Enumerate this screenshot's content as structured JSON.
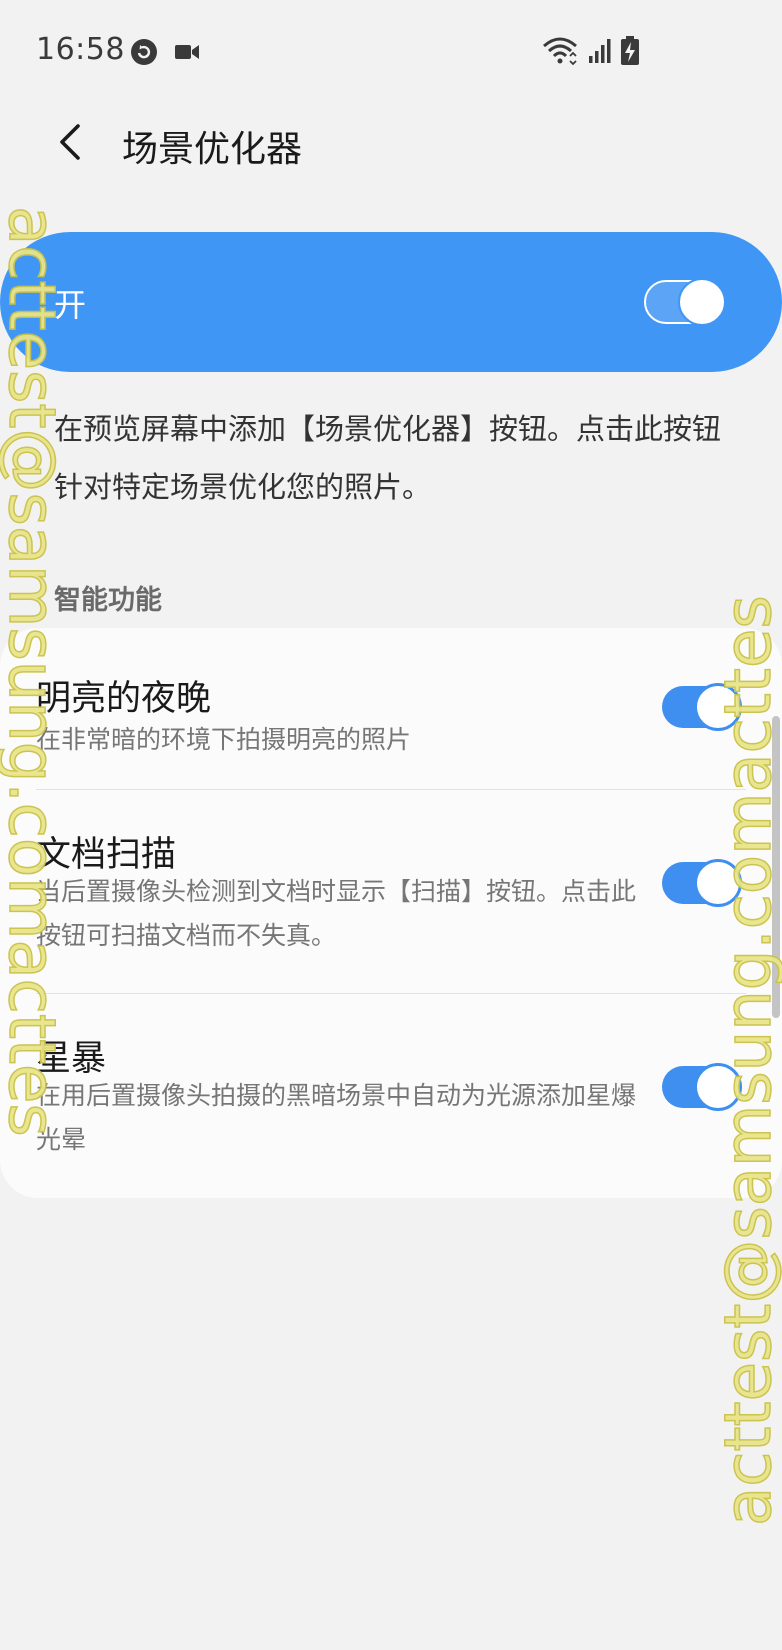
{
  "status_bar": {
    "time": "16:58",
    "icons": [
      "sync-icon",
      "video-icon",
      "wifi-icon",
      "signal-icon",
      "battery-charging-icon"
    ]
  },
  "app_bar": {
    "back_icon": "chevron-left-icon",
    "title": "场景优化器"
  },
  "master": {
    "label": "开",
    "enabled": true
  },
  "description": "在预览屏幕中添加【场景优化器】按钮。点击此按钮针对特定场景优化您的照片。",
  "section": {
    "header": "智能功能"
  },
  "features": [
    {
      "title": "明亮的夜晚",
      "subtitle": "在非常暗的环境下拍摄明亮的照片",
      "enabled": true
    },
    {
      "title": "文档扫描",
      "subtitle": "当后置摄像头检测到文档时显示【扫描】按钮。点击此按钮可扫描文档而不失真。",
      "enabled": true
    },
    {
      "title": "星暴",
      "subtitle": "在用后置摄像头拍摄的黑暗场景中自动为光源添加星爆光晕",
      "enabled": true
    }
  ],
  "watermark": {
    "left": "acttest@samsung.comacttes",
    "right": "acttest@samsung.comacttes"
  },
  "colors": {
    "accent": "#4096f5",
    "background": "#f2f2f2",
    "card": "#fbfbfb"
  }
}
